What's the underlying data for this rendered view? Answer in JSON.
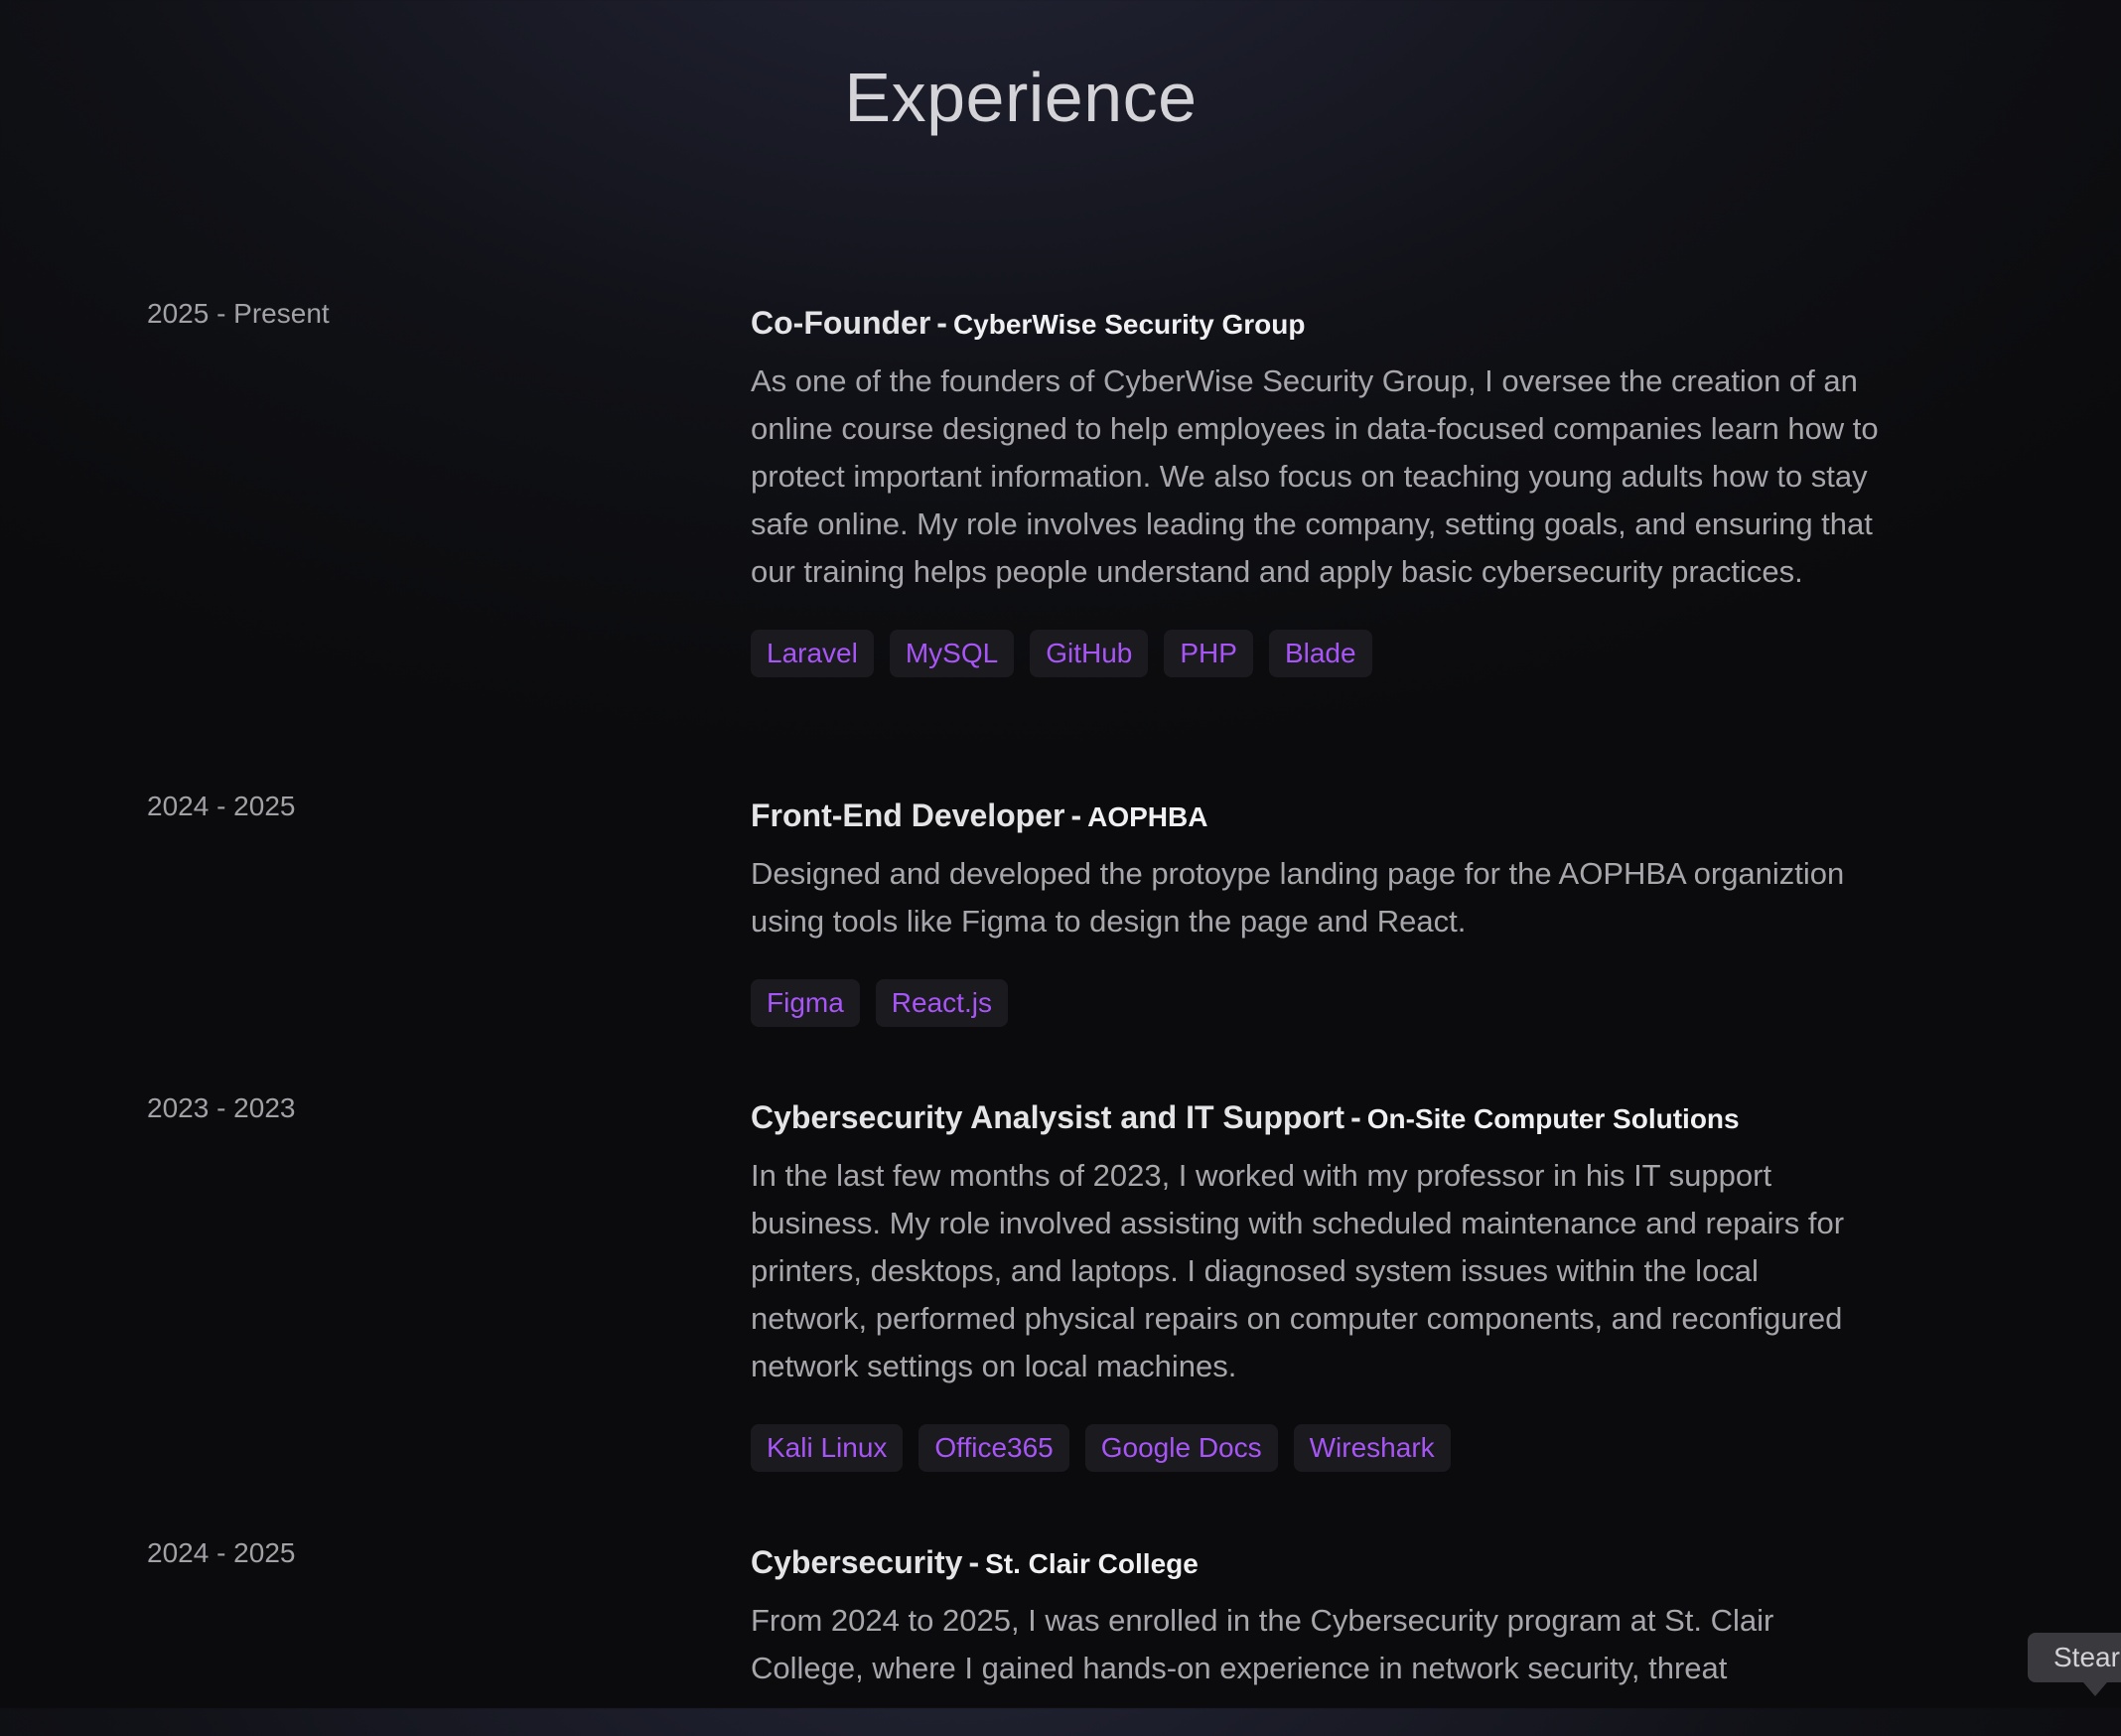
{
  "page": {
    "title": "Experience"
  },
  "colors": {
    "tag_text": "#a855f7",
    "tag_bg": "#1a1a1f",
    "heading": "#e4e4e7",
    "body_text": "#a6a6ab",
    "date_text": "#a1a1a6"
  },
  "experience": [
    {
      "date": "2025 - Present",
      "role": "Co-Founder",
      "separator": "-",
      "org": "CyberWise Security Group",
      "description": "As one of the founders of CyberWise Security Group, I oversee the creation of an online course designed to help employees in data-focused companies learn how to protect important information. We also focus on teaching young adults how to stay safe online. My role involves leading the company, setting goals, and ensuring that our training helps people understand and apply basic cybersecurity practices.",
      "tags": [
        "Laravel",
        "MySQL",
        "GitHub",
        "PHP",
        "Blade"
      ]
    },
    {
      "date": "2024 - 2025",
      "role": "Front-End Developer",
      "separator": "-",
      "org": "AOPHBA",
      "description": "Designed and developed the protoype landing page for the AOPHBA organiztion using tools like Figma to design the page and React.",
      "tags": [
        "Figma",
        "React.js"
      ]
    },
    {
      "date": "2023 - 2023",
      "role": "Cybersecurity Analysist and IT Support",
      "separator": "-",
      "org": "On-Site Computer Solutions",
      "description": "In the last few months of 2023, I worked with my professor in his IT support business. My role involved assisting with scheduled maintenance and repairs for printers, desktops, and laptops. I diagnosed system issues within the local network, performed physical repairs on computer components, and reconfigured network settings on local machines.",
      "tags": [
        "Kali Linux",
        "Office365",
        "Google Docs",
        "Wireshark"
      ]
    },
    {
      "date": "2024 - 2025",
      "role": "Cybersecurity",
      "separator": "-",
      "org": "St. Clair College",
      "description": "From 2024 to 2025, I was enrolled in the Cybersecurity program at St. Clair College, where I gained hands-on experience in network security, threat",
      "tags": []
    }
  ],
  "tooltip": {
    "text": "Stear"
  }
}
